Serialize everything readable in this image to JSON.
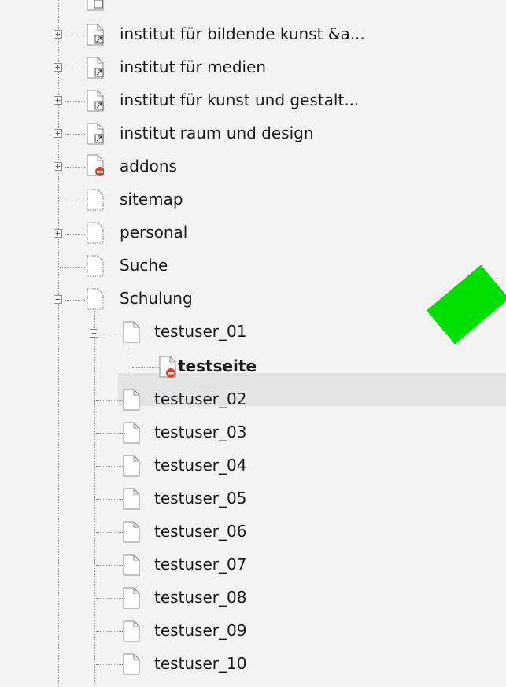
{
  "tree": {
    "nodes": [
      {
        "label": "institut für bildende kunst &a...",
        "toggle": "+",
        "icon": "shortcut-page-icon"
      },
      {
        "label": "institut für medien",
        "toggle": "+",
        "icon": "shortcut-page-icon"
      },
      {
        "label": "institut für kunst und gestalt...",
        "toggle": "+",
        "icon": "shortcut-page-icon"
      },
      {
        "label": "institut raum und design",
        "toggle": "+",
        "icon": "shortcut-page-icon"
      },
      {
        "label": "addons",
        "toggle": "+",
        "icon": "restricted-page-icon"
      },
      {
        "label": "sitemap",
        "toggle": "",
        "icon": "page-icon"
      },
      {
        "label": "personal",
        "toggle": "+",
        "icon": "page-icon"
      },
      {
        "label": "Suche",
        "toggle": "",
        "icon": "page-icon"
      },
      {
        "label": "Schulung",
        "toggle": "−",
        "icon": "page-icon"
      },
      {
        "label": "testuser_01",
        "toggle": "−",
        "icon": "page-icon"
      },
      {
        "label": "testseite",
        "toggle": "",
        "icon": "restricted-page-icon"
      },
      {
        "label": "testuser_02",
        "toggle": "",
        "icon": "page-icon"
      },
      {
        "label": "testuser_03",
        "toggle": "",
        "icon": "page-icon"
      },
      {
        "label": "testuser_04",
        "toggle": "",
        "icon": "page-icon"
      },
      {
        "label": "testuser_05",
        "toggle": "",
        "icon": "page-icon"
      },
      {
        "label": "testuser_06",
        "toggle": "",
        "icon": "page-icon"
      },
      {
        "label": "testuser_07",
        "toggle": "",
        "icon": "page-icon"
      },
      {
        "label": "testuser_08",
        "toggle": "",
        "icon": "page-icon"
      },
      {
        "label": "testuser_09",
        "toggle": "",
        "icon": "page-icon"
      },
      {
        "label": "testuser_10",
        "toggle": "",
        "icon": "page-icon"
      }
    ],
    "selected": "testseite"
  },
  "colors": {
    "selection_bg": "#e2e4e6",
    "pointer_arrow": "#00e000",
    "restricted_badge": "#d9452b"
  }
}
